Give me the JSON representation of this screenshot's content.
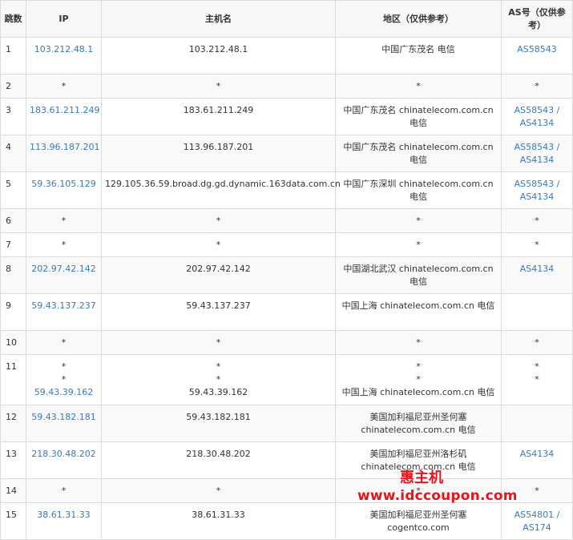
{
  "headers": {
    "hop": "跳数",
    "ip": "IP",
    "host": "主机名",
    "region": "地区（仅供参考）",
    "as": "AS号（仅供参考）"
  },
  "rows": [
    {
      "hop": "1",
      "ip": [
        "103.212.48.1"
      ],
      "host": [
        "103.212.48.1"
      ],
      "region": "中国广东茂名 电信",
      "as": [
        "AS58543"
      ]
    },
    {
      "hop": "2",
      "ip": [
        "*"
      ],
      "host": [
        "*"
      ],
      "region": "*",
      "as": [
        "*"
      ]
    },
    {
      "hop": "3",
      "ip": [
        "183.61.211.249"
      ],
      "host": [
        "183.61.211.249"
      ],
      "region": "中国广东茂名 chinatelecom.com.cn 电信",
      "as": [
        "AS58543 /",
        "AS4134"
      ]
    },
    {
      "hop": "4",
      "ip": [
        "113.96.187.201"
      ],
      "host": [
        "113.96.187.201"
      ],
      "region": "中国广东茂名 chinatelecom.com.cn 电信",
      "as": [
        "AS58543 /",
        "AS4134"
      ]
    },
    {
      "hop": "5",
      "ip": [
        "59.36.105.129"
      ],
      "host": [
        "129.105.36.59.broad.dg.gd.dynamic.163data.com.cn"
      ],
      "region": "中国广东深圳 chinatelecom.com.cn 电信",
      "as": [
        "AS58543 /",
        "AS4134"
      ]
    },
    {
      "hop": "6",
      "ip": [
        "*"
      ],
      "host": [
        "*"
      ],
      "region": "*",
      "as": [
        "*"
      ]
    },
    {
      "hop": "7",
      "ip": [
        "*"
      ],
      "host": [
        "*"
      ],
      "region": "*",
      "as": [
        "*"
      ]
    },
    {
      "hop": "8",
      "ip": [
        "202.97.42.142"
      ],
      "host": [
        "202.97.42.142"
      ],
      "region": "中国湖北武汉 chinatelecom.com.cn 电信",
      "as": [
        "AS4134"
      ]
    },
    {
      "hop": "9",
      "ip": [
        "59.43.137.237"
      ],
      "host": [
        "59.43.137.237"
      ],
      "region": "中国上海 chinatelecom.com.cn 电信",
      "as": []
    },
    {
      "hop": "10",
      "ip": [
        "*"
      ],
      "host": [
        "*"
      ],
      "region": "*",
      "as": [
        "*"
      ]
    },
    {
      "hop": "11",
      "ip": [
        "*",
        "*",
        "59.43.39.162"
      ],
      "host": [
        "*",
        "*",
        "59.43.39.162"
      ],
      "region_lines": [
        "*",
        "*",
        "中国上海 chinatelecom.com.cn 电信"
      ],
      "as": [
        "*",
        "*"
      ]
    },
    {
      "hop": "12",
      "ip": [
        "59.43.182.181"
      ],
      "host": [
        "59.43.182.181"
      ],
      "region": "美国加利福尼亚州圣何塞 chinatelecom.com.cn 电信",
      "as": []
    },
    {
      "hop": "13",
      "ip": [
        "218.30.48.202"
      ],
      "host": [
        "218.30.48.202"
      ],
      "region": "美国加利福尼亚州洛杉矶 chinatelecom.com.cn 电信",
      "as": [
        "AS4134"
      ]
    },
    {
      "hop": "14",
      "ip": [
        "*"
      ],
      "host": [
        "*"
      ],
      "region": "*",
      "as": [
        "*"
      ]
    },
    {
      "hop": "15",
      "ip": [
        "38.61.31.33"
      ],
      "host": [
        "38.61.31.33"
      ],
      "region": "美国加利福尼亚州圣何塞 cogentco.com",
      "as": [
        "AS54801 /",
        "AS174"
      ]
    }
  ],
  "watermark": {
    "line1": "惠主机",
    "line2": "www.idccoupon.com",
    "color": "#e8141b"
  },
  "colors": {
    "link": "#3b79b5",
    "border": "#dcdcdc"
  }
}
